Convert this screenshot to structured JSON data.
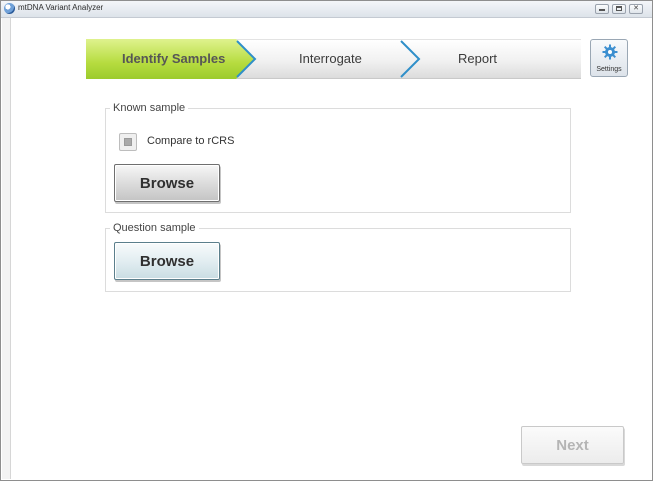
{
  "window": {
    "title": "mtDNA Variant Analyzer",
    "controls": [
      "minimize",
      "maximize",
      "close"
    ]
  },
  "wizard": {
    "steps": [
      {
        "label": "Identify Samples",
        "state": "active"
      },
      {
        "label": "Interrogate",
        "state": "inactive"
      },
      {
        "label": "Report",
        "state": "inactive"
      }
    ],
    "active_color": "#b6dc3f"
  },
  "settings": {
    "label": "Settings",
    "icon": "gear-icon"
  },
  "known_sample": {
    "title": "Known sample",
    "compare_checkbox": {
      "label": "Compare to rCRS",
      "checked": false
    },
    "browse_label": "Browse"
  },
  "question_sample": {
    "title": "Question sample",
    "browse_label": "Browse"
  },
  "footer": {
    "next_label": "Next",
    "next_enabled": false
  }
}
